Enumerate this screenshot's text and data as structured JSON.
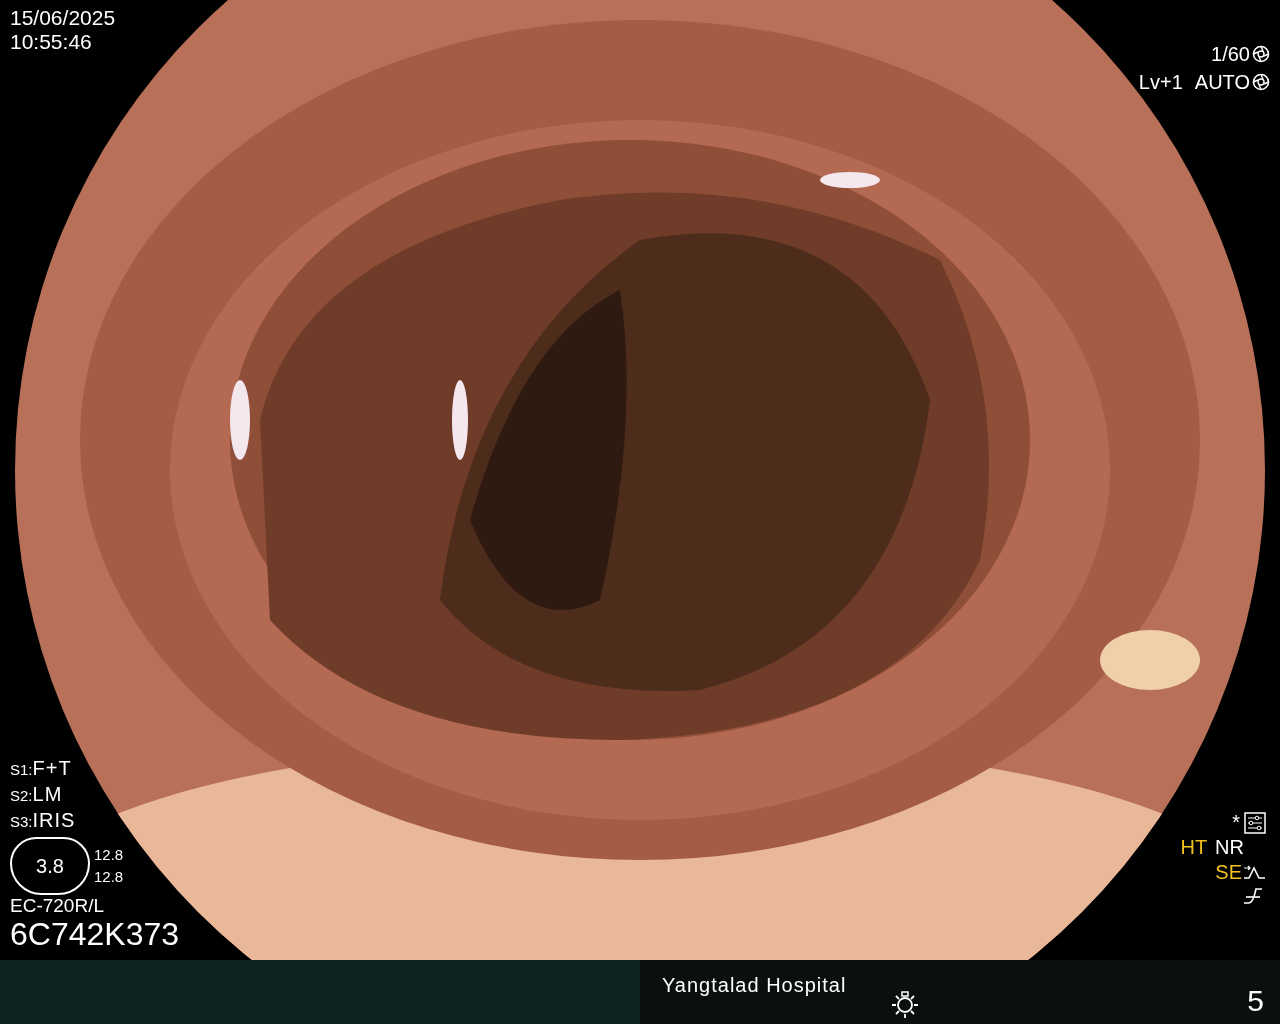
{
  "datetime": {
    "date": "15/06/2025",
    "time": "10:55:46"
  },
  "exposure": {
    "shutter": "1/60",
    "brightness": "Lv+1",
    "mode": "AUTO"
  },
  "switches": [
    {
      "label": "S1:",
      "value": "F+T"
    },
    {
      "label": "S2:",
      "value": "LM"
    },
    {
      "label": "S3:",
      "value": "IRIS"
    }
  ],
  "zoom_gauge": {
    "value": "3.8",
    "readings": [
      "12.8",
      "12.8"
    ]
  },
  "scope": {
    "model": "EC-720R/L",
    "serial": "6C742K373"
  },
  "asterisk": "*",
  "indicators": [
    {
      "label": "HT",
      "color": "#f0c020"
    },
    {
      "label": "NR",
      "color": "#ffffff"
    },
    {
      "label": "SE",
      "color": "#f0c020"
    }
  ],
  "footer": {
    "hospital": "Yangtalad Hospital",
    "number": "5"
  }
}
